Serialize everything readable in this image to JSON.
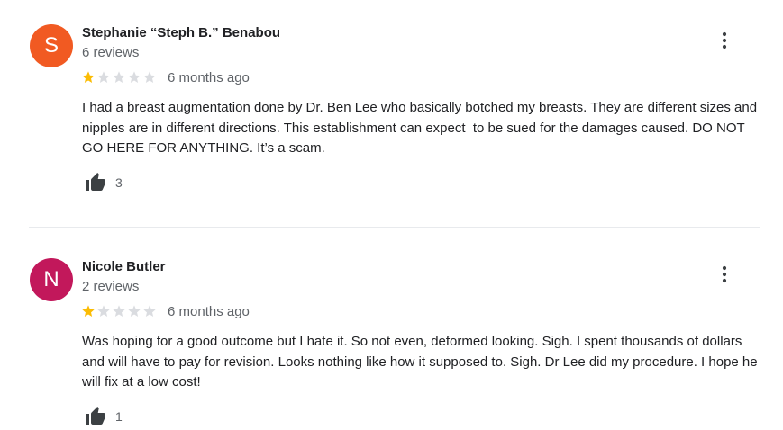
{
  "colors": {
    "avatar_1": "#f15a22",
    "avatar_2": "#c2185b",
    "star_filled": "#fbbc04",
    "star_empty": "#dadce0",
    "icon": "#3c4043"
  },
  "reviews": [
    {
      "avatar_letter": "S",
      "author": "Stephanie “Steph B.” Benabou",
      "review_count": "6 reviews",
      "rating": 1,
      "date": "6 months ago",
      "text": "I had a breast augmentation done by Dr. Ben Lee who basically botched my breasts. They are different sizes and nipples are in different directions. This establishment can expect  to be sued for the damages caused. DO NOT GO HERE FOR ANYTHING. It’s a scam.",
      "likes": "3",
      "like_icon": "thumbs-up-icon",
      "more_icon": "more-vert-icon"
    },
    {
      "avatar_letter": "N",
      "author": "Nicole Butler",
      "review_count": "2 reviews",
      "rating": 1,
      "date": "6 months ago",
      "text": "Was hoping for a good outcome but I hate it. So not even, deformed looking. Sigh. I spent thousands of dollars and will have to pay for revision. Looks nothing like how it supposed to. Sigh. Dr Lee did my procedure. I hope he will fix at a low cost!",
      "likes": "1",
      "like_icon": "thumbs-up-icon",
      "more_icon": "more-vert-icon"
    }
  ]
}
